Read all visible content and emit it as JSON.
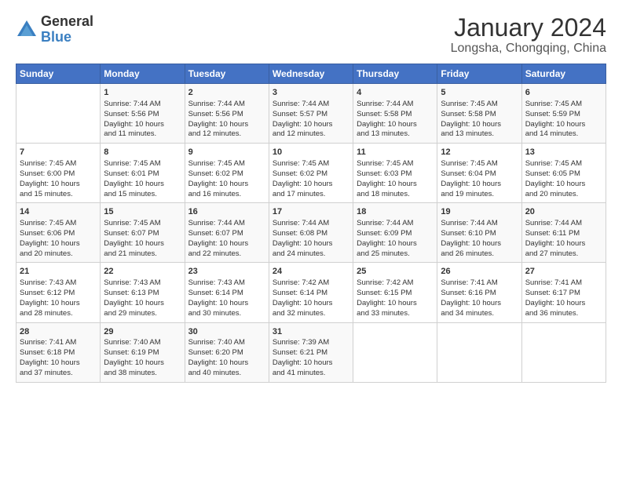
{
  "logo": {
    "general": "General",
    "blue": "Blue"
  },
  "title": "January 2024",
  "subtitle": "Longsha, Chongqing, China",
  "headers": [
    "Sunday",
    "Monday",
    "Tuesday",
    "Wednesday",
    "Thursday",
    "Friday",
    "Saturday"
  ],
  "weeks": [
    [
      {
        "day": "",
        "info": ""
      },
      {
        "day": "1",
        "info": "Sunrise: 7:44 AM\nSunset: 5:56 PM\nDaylight: 10 hours\nand 11 minutes."
      },
      {
        "day": "2",
        "info": "Sunrise: 7:44 AM\nSunset: 5:56 PM\nDaylight: 10 hours\nand 12 minutes."
      },
      {
        "day": "3",
        "info": "Sunrise: 7:44 AM\nSunset: 5:57 PM\nDaylight: 10 hours\nand 12 minutes."
      },
      {
        "day": "4",
        "info": "Sunrise: 7:44 AM\nSunset: 5:58 PM\nDaylight: 10 hours\nand 13 minutes."
      },
      {
        "day": "5",
        "info": "Sunrise: 7:45 AM\nSunset: 5:58 PM\nDaylight: 10 hours\nand 13 minutes."
      },
      {
        "day": "6",
        "info": "Sunrise: 7:45 AM\nSunset: 5:59 PM\nDaylight: 10 hours\nand 14 minutes."
      }
    ],
    [
      {
        "day": "7",
        "info": "Sunrise: 7:45 AM\nSunset: 6:00 PM\nDaylight: 10 hours\nand 15 minutes."
      },
      {
        "day": "8",
        "info": "Sunrise: 7:45 AM\nSunset: 6:01 PM\nDaylight: 10 hours\nand 15 minutes."
      },
      {
        "day": "9",
        "info": "Sunrise: 7:45 AM\nSunset: 6:02 PM\nDaylight: 10 hours\nand 16 minutes."
      },
      {
        "day": "10",
        "info": "Sunrise: 7:45 AM\nSunset: 6:02 PM\nDaylight: 10 hours\nand 17 minutes."
      },
      {
        "day": "11",
        "info": "Sunrise: 7:45 AM\nSunset: 6:03 PM\nDaylight: 10 hours\nand 18 minutes."
      },
      {
        "day": "12",
        "info": "Sunrise: 7:45 AM\nSunset: 6:04 PM\nDaylight: 10 hours\nand 19 minutes."
      },
      {
        "day": "13",
        "info": "Sunrise: 7:45 AM\nSunset: 6:05 PM\nDaylight: 10 hours\nand 20 minutes."
      }
    ],
    [
      {
        "day": "14",
        "info": "Sunrise: 7:45 AM\nSunset: 6:06 PM\nDaylight: 10 hours\nand 20 minutes."
      },
      {
        "day": "15",
        "info": "Sunrise: 7:45 AM\nSunset: 6:07 PM\nDaylight: 10 hours\nand 21 minutes."
      },
      {
        "day": "16",
        "info": "Sunrise: 7:44 AM\nSunset: 6:07 PM\nDaylight: 10 hours\nand 22 minutes."
      },
      {
        "day": "17",
        "info": "Sunrise: 7:44 AM\nSunset: 6:08 PM\nDaylight: 10 hours\nand 24 minutes."
      },
      {
        "day": "18",
        "info": "Sunrise: 7:44 AM\nSunset: 6:09 PM\nDaylight: 10 hours\nand 25 minutes."
      },
      {
        "day": "19",
        "info": "Sunrise: 7:44 AM\nSunset: 6:10 PM\nDaylight: 10 hours\nand 26 minutes."
      },
      {
        "day": "20",
        "info": "Sunrise: 7:44 AM\nSunset: 6:11 PM\nDaylight: 10 hours\nand 27 minutes."
      }
    ],
    [
      {
        "day": "21",
        "info": "Sunrise: 7:43 AM\nSunset: 6:12 PM\nDaylight: 10 hours\nand 28 minutes."
      },
      {
        "day": "22",
        "info": "Sunrise: 7:43 AM\nSunset: 6:13 PM\nDaylight: 10 hours\nand 29 minutes."
      },
      {
        "day": "23",
        "info": "Sunrise: 7:43 AM\nSunset: 6:14 PM\nDaylight: 10 hours\nand 30 minutes."
      },
      {
        "day": "24",
        "info": "Sunrise: 7:42 AM\nSunset: 6:14 PM\nDaylight: 10 hours\nand 32 minutes."
      },
      {
        "day": "25",
        "info": "Sunrise: 7:42 AM\nSunset: 6:15 PM\nDaylight: 10 hours\nand 33 minutes."
      },
      {
        "day": "26",
        "info": "Sunrise: 7:41 AM\nSunset: 6:16 PM\nDaylight: 10 hours\nand 34 minutes."
      },
      {
        "day": "27",
        "info": "Sunrise: 7:41 AM\nSunset: 6:17 PM\nDaylight: 10 hours\nand 36 minutes."
      }
    ],
    [
      {
        "day": "28",
        "info": "Sunrise: 7:41 AM\nSunset: 6:18 PM\nDaylight: 10 hours\nand 37 minutes."
      },
      {
        "day": "29",
        "info": "Sunrise: 7:40 AM\nSunset: 6:19 PM\nDaylight: 10 hours\nand 38 minutes."
      },
      {
        "day": "30",
        "info": "Sunrise: 7:40 AM\nSunset: 6:20 PM\nDaylight: 10 hours\nand 40 minutes."
      },
      {
        "day": "31",
        "info": "Sunrise: 7:39 AM\nSunset: 6:21 PM\nDaylight: 10 hours\nand 41 minutes."
      },
      {
        "day": "",
        "info": ""
      },
      {
        "day": "",
        "info": ""
      },
      {
        "day": "",
        "info": ""
      }
    ]
  ]
}
